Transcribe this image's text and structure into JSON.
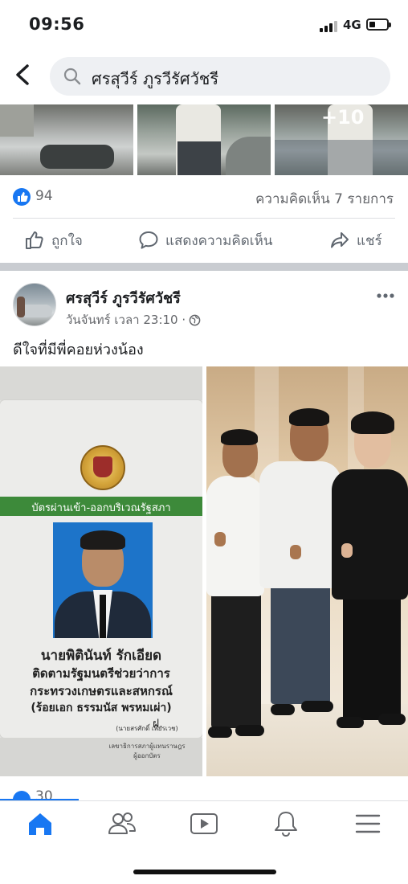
{
  "status_bar": {
    "time": "09:56",
    "network": "4G",
    "signal_bars": 3,
    "battery_level": 0.35
  },
  "search": {
    "query": "ศรสุวีร์ ภูรวีรัศวัชรี"
  },
  "top_strip": {
    "more_photos_label": "+10"
  },
  "reactions": {
    "like_count": "94",
    "comments": "ความคิดเห็น 7 รายการ"
  },
  "actions": {
    "like": "ถูกใจ",
    "comment": "แสดงความคิดเห็น",
    "share": "แชร์"
  },
  "post": {
    "author": "ศรสุวีร์ ภูรวีรัศวัชรี",
    "timestamp": "วันจันทร์ เวลา 23:10 ·",
    "text": "ดีใจที่มีพี่คอยห่วงน้อง"
  },
  "card": {
    "band_text": "บัตรผ่านเข้า-ออกบริเวณรัฐสภา",
    "name": "นายพิตินันท์  รักเอียด",
    "position": "ติดตามรัฐมนตรีช่วยว่าการ",
    "ministry": "กระทรวงเกษตรและสหกรณ์",
    "sponsor": "(ร้อยเอก ธรรมนัส  พรหมเผ่า)",
    "signature": "ฝ.",
    "issuer_name": "(นายสรศักดิ์  เพียรเวช)",
    "issuer_title": "เลขาธิการสภาผู้แทนราษฎร",
    "issuer_role": "ผู้ออกบัตร"
  },
  "next_post": {
    "like_count": "30"
  },
  "colors": {
    "brand_blue": "#1877f2",
    "text_secondary": "#65676b",
    "card_band_green": "#3d8a3a"
  },
  "icons": {
    "back": "chevron-left-icon",
    "search": "search-icon",
    "like": "thumbs-up-icon",
    "comment": "speech-bubble-icon",
    "share": "share-arrow-icon",
    "globe": "globe-icon",
    "more": "more-dots-icon",
    "nav": [
      "home-icon",
      "friends-icon",
      "watch-icon",
      "bell-icon",
      "menu-icon"
    ]
  }
}
